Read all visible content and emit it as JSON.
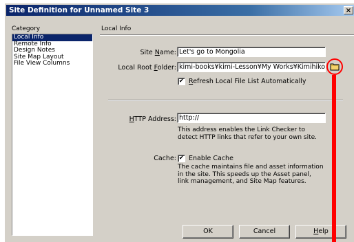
{
  "window": {
    "title": "Site Definition for Unnamed Site 3",
    "close_label": "×"
  },
  "category": {
    "heading": "Category",
    "items": [
      {
        "label": "Local Info",
        "selected": true
      },
      {
        "label": "Remote Info",
        "selected": false
      },
      {
        "label": "Design Notes",
        "selected": false
      },
      {
        "label": "Site Map Layout",
        "selected": false
      },
      {
        "label": "File View Columns",
        "selected": false
      }
    ]
  },
  "local_info": {
    "section_title": "Local Info",
    "site_name_label": "Site Name:",
    "site_name_value": "Let's go to Mongolia",
    "local_root_label": "Local Root Folder:",
    "local_root_value": "kimi-books¥kimi-Lesson¥My Works¥Kimihiko¥",
    "folder_icon": "folder-icon",
    "refresh_label": "Refresh Local File List Automatically",
    "refresh_checked": true,
    "http_label": "HTTP Address:",
    "http_value": "http://",
    "http_desc": [
      "This address enables the Link Checker to",
      "detect HTTP links that refer to your own site."
    ],
    "cache_label": "Cache:",
    "cache_checkbox_label": "Enable Cache",
    "cache_checked": true,
    "cache_desc": [
      "The cache maintains file and asset information",
      "in the site.  This speeds up the Asset panel,",
      "link management, and Site Map features."
    ]
  },
  "buttons": {
    "ok": "OK",
    "cancel": "Cancel",
    "help": "Help"
  },
  "annotation": {
    "color": "#ff0000"
  }
}
